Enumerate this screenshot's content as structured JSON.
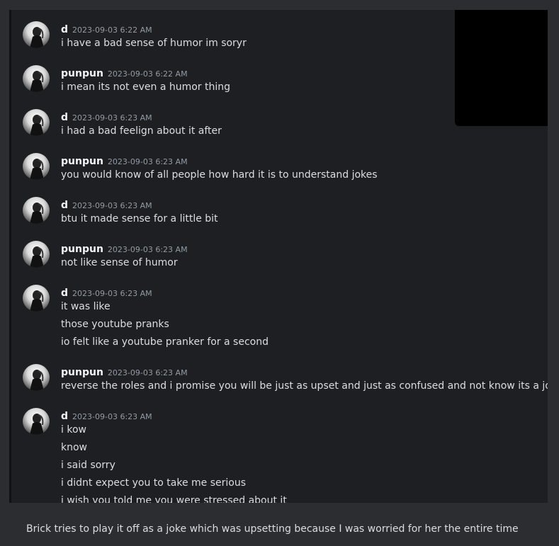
{
  "messages": [
    {
      "user": "d",
      "time": "2023-09-03 6:22 AM",
      "lines": [
        "i have a bad sense of humor im soryr"
      ]
    },
    {
      "user": "punpun",
      "time": "2023-09-03 6:22 AM",
      "lines": [
        "i mean its not even a humor thing"
      ]
    },
    {
      "user": "d",
      "time": "2023-09-03 6:23 AM",
      "lines": [
        "i had a bad feelign about it after"
      ]
    },
    {
      "user": "punpun",
      "time": "2023-09-03 6:23 AM",
      "lines": [
        "you would know of all people how hard it is to understand jokes"
      ]
    },
    {
      "user": "d",
      "time": "2023-09-03 6:23 AM",
      "lines": [
        "btu it made sense for a little bit"
      ]
    },
    {
      "user": "punpun",
      "time": "2023-09-03 6:23 AM",
      "lines": [
        "not like sense of humor"
      ]
    },
    {
      "user": "d",
      "time": "2023-09-03 6:23 AM",
      "lines": [
        "it was like",
        "those youtube pranks",
        "io felt like a youtube pranker for a second"
      ]
    },
    {
      "user": "punpun",
      "time": "2023-09-03 6:23 AM",
      "lines": [
        "reverse the roles and i promise you will be just as upset and just as confused and not know its a joke"
      ]
    },
    {
      "user": "d",
      "time": "2023-09-03 6:23 AM",
      "lines": [
        "i kow",
        "know",
        "i said sorry",
        "i didnt expect  you to take me serious",
        "i wish you told me you were stressed about it"
      ]
    }
  ],
  "caption": "Brick tries to play it off as a joke which was upsetting because I was worried for her the entire time",
  "colors": {
    "background": "#2b2d31",
    "panel": "#1e1f22",
    "username": "#f2f3f5",
    "timestamp": "#949ba4",
    "text": "#dbdee1"
  }
}
